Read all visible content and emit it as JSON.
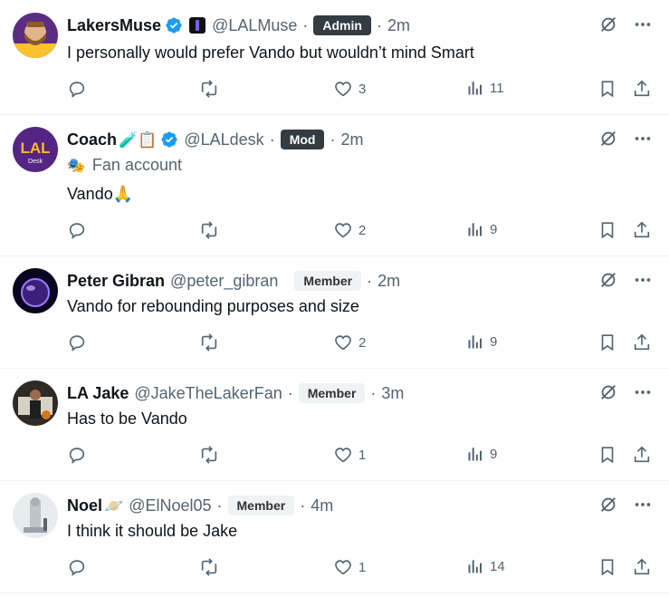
{
  "colors": {
    "text": "#0f1419",
    "secondary": "#536471",
    "verified_blue": "#1d9bf0",
    "divider": "#eff3f4"
  },
  "posts": [
    {
      "name": "LakersMuse",
      "name_emoji": "",
      "verified": true,
      "affiliate": true,
      "handle": "@LALMuse",
      "badge": "Admin",
      "badge_style": "dark",
      "time": "2m",
      "fan_label": "",
      "text": "I personally would prefer Vando but wouldn’t mind Smart",
      "reply_count": "",
      "retweet_count": "",
      "like_count": "3",
      "view_count": "11",
      "avatar_icon": "bearded-player-avatar"
    },
    {
      "name": "Coach",
      "name_emoji": "🧪📋",
      "verified": true,
      "affiliate": false,
      "handle": "@LALdesk",
      "badge": "Mod",
      "badge_style": "dark",
      "time": "2m",
      "fan_label": "Fan account",
      "text": "Vando🙏",
      "reply_count": "",
      "retweet_count": "",
      "like_count": "2",
      "view_count": "9",
      "avatar_icon": "lal-desk-logo"
    },
    {
      "name": "Peter Gibran",
      "name_emoji": "",
      "verified": false,
      "affiliate": false,
      "handle": "@peter_gibran",
      "badge": "Member",
      "badge_style": "light",
      "time": "2m",
      "fan_label": "",
      "text": "Vando for rebounding purposes and size",
      "reply_count": "",
      "retweet_count": "",
      "like_count": "2",
      "view_count": "9",
      "avatar_icon": "purple-orb-avatar"
    },
    {
      "name": "LA Jake",
      "name_emoji": "",
      "verified": false,
      "affiliate": false,
      "handle": "@JakeTheLakerFan",
      "badge": "Member",
      "badge_style": "light",
      "time": "3m",
      "fan_label": "",
      "text": "Has to be Vando",
      "reply_count": "",
      "retweet_count": "",
      "like_count": "1",
      "view_count": "9",
      "avatar_icon": "person-photo-avatar"
    },
    {
      "name": "Noel",
      "name_emoji": "🪐",
      "verified": false,
      "affiliate": false,
      "handle": "@ElNoel05",
      "badge": "Member",
      "badge_style": "light",
      "time": "4m",
      "fan_label": "",
      "text": "I think it should be Jake",
      "reply_count": "",
      "retweet_count": "",
      "like_count": "1",
      "view_count": "14",
      "avatar_icon": "statue-photo-avatar"
    }
  ],
  "separators": {
    "dot": "·"
  }
}
